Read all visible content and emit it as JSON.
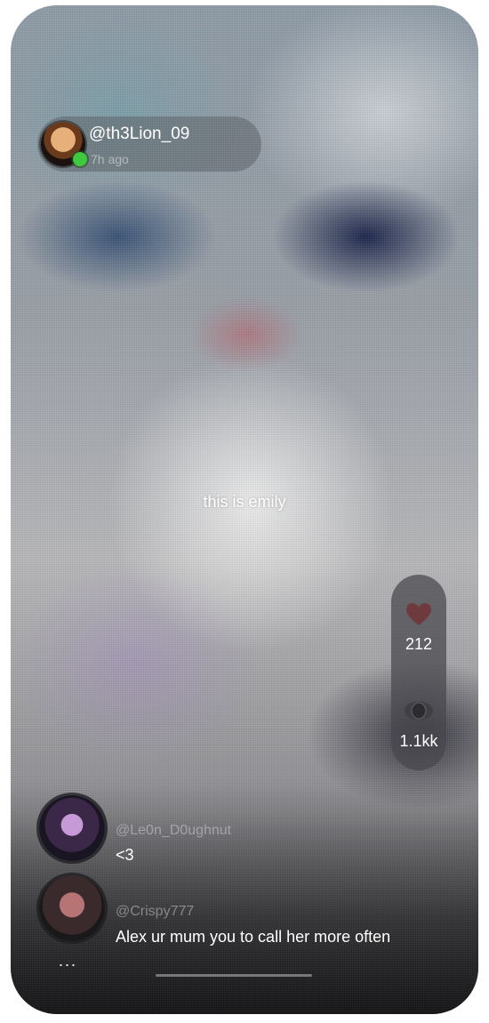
{
  "post": {
    "author": "@th3Lion_09",
    "time": "7h ago",
    "caption": "this is emily"
  },
  "stats": {
    "likes": "212",
    "views": "1.1kk",
    "like_icon": "heart-icon",
    "view_icon": "eye-icon"
  },
  "comments": [
    {
      "user": "@Le0n_D0ughnut",
      "text": "<3"
    },
    {
      "user": "@Crispy777",
      "text": "Alex ur mum you to call her more often"
    }
  ],
  "more": "...",
  "colors": {
    "online": "#3ec93e",
    "stats_bg": "#46464c",
    "heart": "#6e3a3e"
  }
}
